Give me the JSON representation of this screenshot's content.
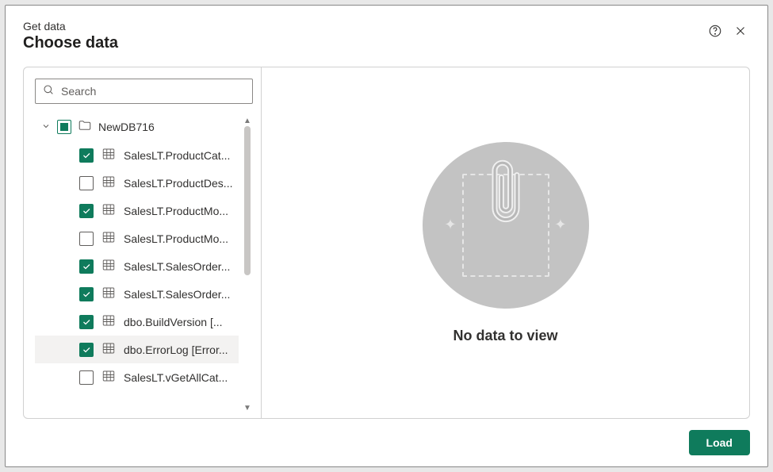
{
  "header": {
    "subtitle": "Get data",
    "title": "Choose data"
  },
  "search": {
    "placeholder": "Search",
    "value": ""
  },
  "database": {
    "name": "NewDB716",
    "expanded": true,
    "state": "partial"
  },
  "tables": [
    {
      "label": "SalesLT.ProductCat...",
      "checked": true,
      "selected": false
    },
    {
      "label": "SalesLT.ProductDes...",
      "checked": false,
      "selected": false
    },
    {
      "label": "SalesLT.ProductMo...",
      "checked": true,
      "selected": false
    },
    {
      "label": "SalesLT.ProductMo...",
      "checked": false,
      "selected": false
    },
    {
      "label": "SalesLT.SalesOrder...",
      "checked": true,
      "selected": false
    },
    {
      "label": "SalesLT.SalesOrder...",
      "checked": true,
      "selected": false
    },
    {
      "label": "dbo.BuildVersion [...",
      "checked": true,
      "selected": false
    },
    {
      "label": "dbo.ErrorLog [Error...",
      "checked": true,
      "selected": true
    },
    {
      "label": "SalesLT.vGetAllCat...",
      "checked": false,
      "selected": false
    }
  ],
  "preview": {
    "empty_message": "No data to view"
  },
  "footer": {
    "load_label": "Load"
  }
}
